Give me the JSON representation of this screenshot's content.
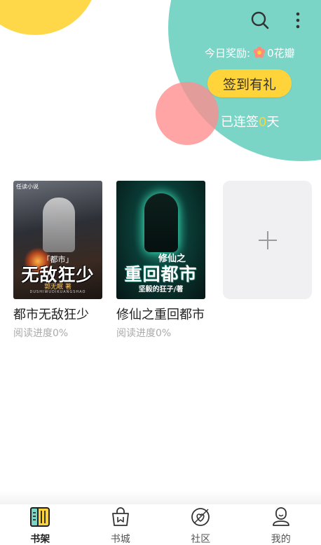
{
  "header": {
    "search_icon": "search-icon",
    "more_icon": "more-vertical-icon"
  },
  "reward": {
    "label": "今日奖励:",
    "flower_icon": "flower-icon",
    "amount": "0花瓣"
  },
  "signin": {
    "button_label": "签到有礼"
  },
  "streak": {
    "prefix": "已连签",
    "days": "0",
    "suffix": "天"
  },
  "books": [
    {
      "title": "都市无敌狂少",
      "progress": "阅读进度0%",
      "cover": {
        "logo": "任读小说",
        "small": "「都市」",
        "big": "无敌狂少",
        "author": "郭无眠 著",
        "pinyin": "DUSHIWUDIKUANGSHAO"
      }
    },
    {
      "title": "修仙之重回都市",
      "progress": "阅读进度0%",
      "cover": {
        "small": "修仙之",
        "big": "重回都市",
        "author": "坚毅的狂子/著"
      }
    }
  ],
  "add_card": {
    "icon": "plus-icon"
  },
  "nav": {
    "items": [
      {
        "label": "书架",
        "icon": "bookshelf-icon",
        "active": true
      },
      {
        "label": "书城",
        "icon": "bookstore-bag-icon",
        "active": false
      },
      {
        "label": "社区",
        "icon": "community-icon",
        "active": false
      },
      {
        "label": "我的",
        "icon": "profile-icon",
        "active": false
      }
    ]
  },
  "colors": {
    "teal": "#7AD5C6",
    "yellow": "#FFD84A",
    "pink": "#FF8C8C",
    "button": "#FFD33A"
  }
}
